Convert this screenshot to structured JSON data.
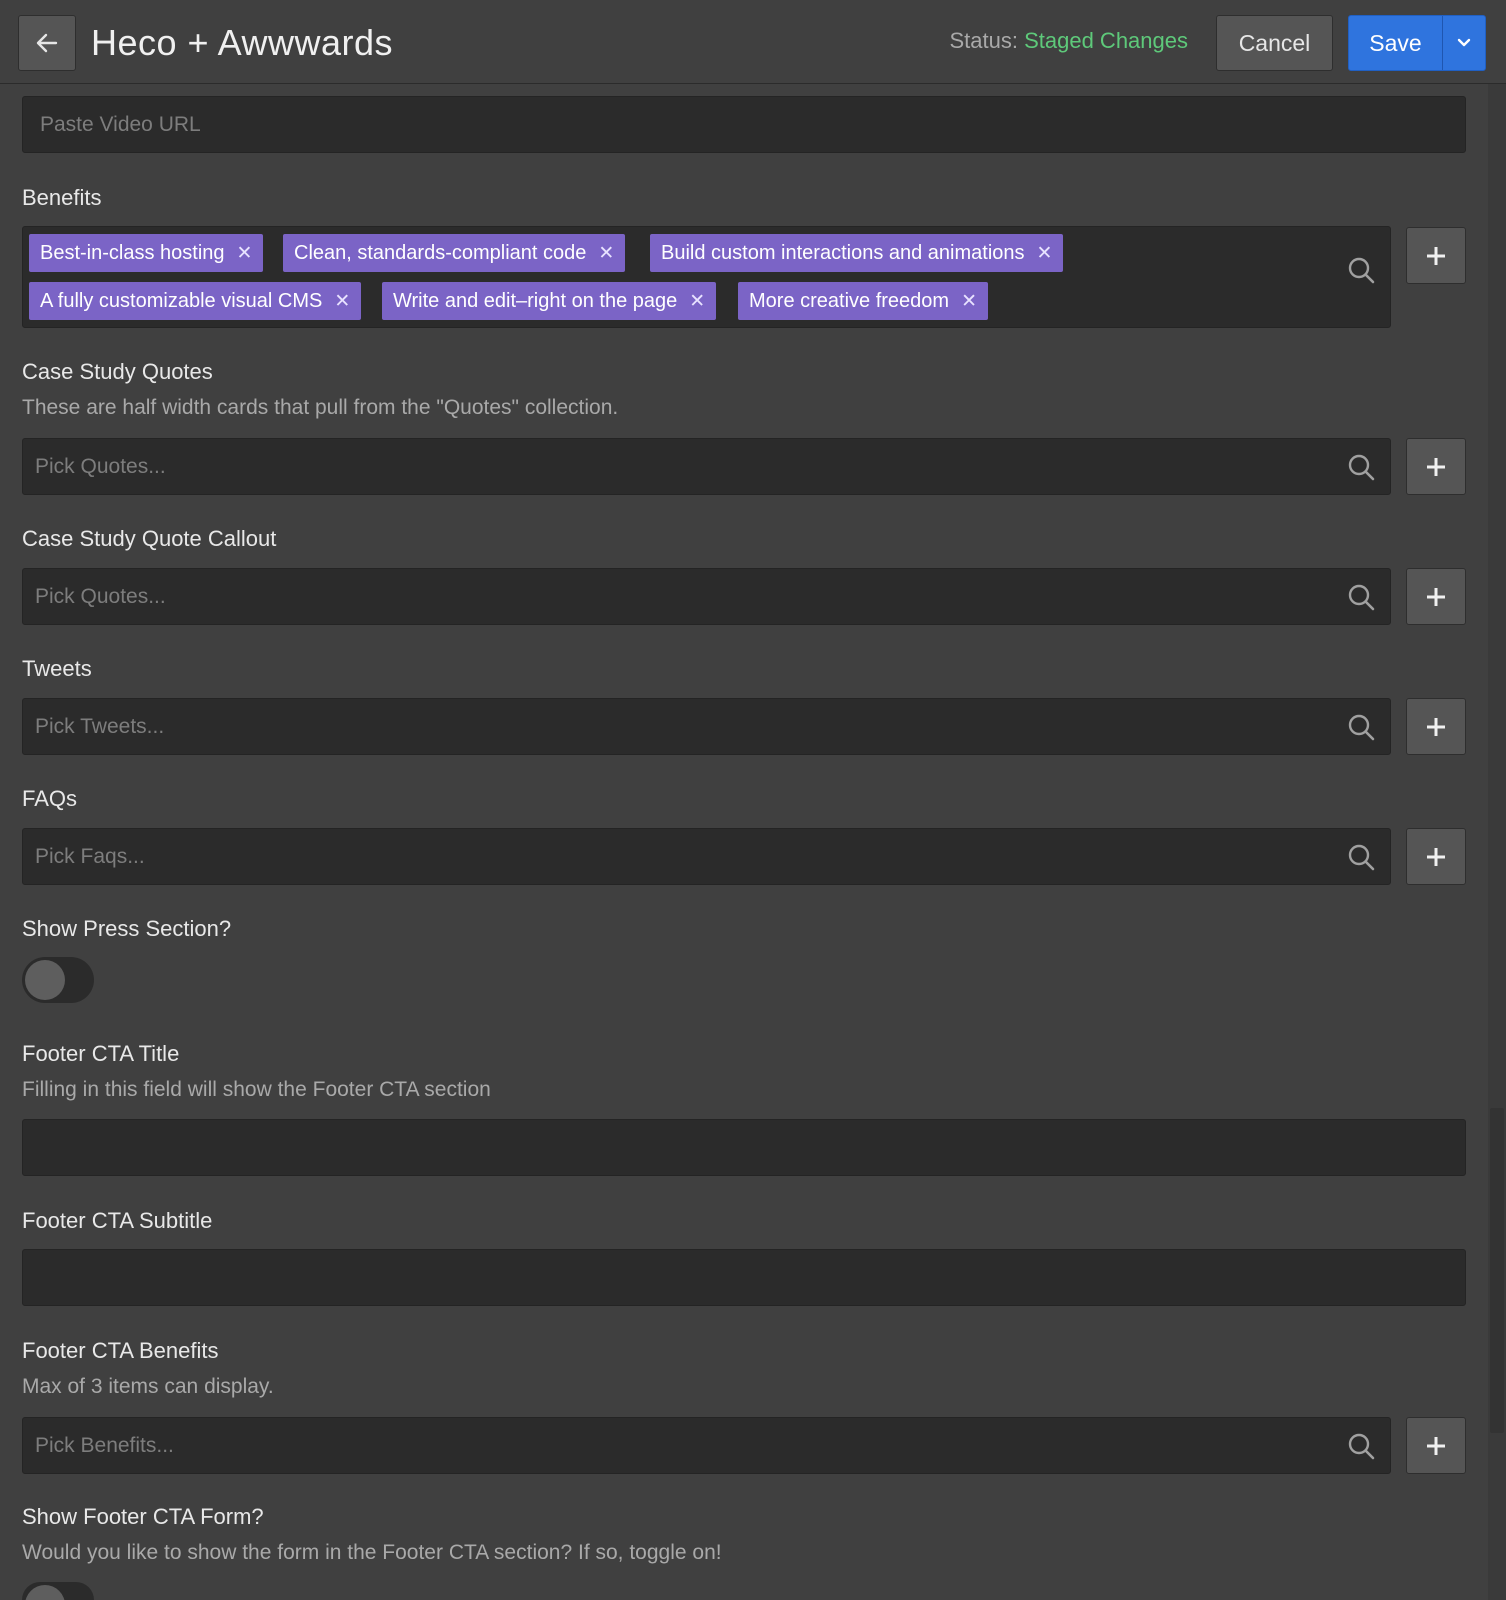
{
  "header": {
    "title": "Heco + Awwwards",
    "status_label": "Status:",
    "status_value": "Staged Changes",
    "cancel_label": "Cancel",
    "save_label": "Save"
  },
  "video": {
    "placeholder": "Paste Video URL"
  },
  "benefits": {
    "label": "Benefits",
    "tags": [
      "Best-in-class hosting",
      "Clean, standards-compliant code",
      "Build custom interactions and animations",
      "A fully customizable visual CMS",
      "Write and edit–right on the page",
      "More creative freedom"
    ]
  },
  "case_study_quotes": {
    "label": "Case Study Quotes",
    "help": "These are half width cards that pull from the \"Quotes\" collection.",
    "placeholder": "Pick Quotes..."
  },
  "case_study_quote_callout": {
    "label": "Case Study Quote Callout",
    "placeholder": "Pick Quotes..."
  },
  "tweets": {
    "label": "Tweets",
    "placeholder": "Pick Tweets..."
  },
  "faqs": {
    "label": "FAQs",
    "placeholder": "Pick Faqs..."
  },
  "press": {
    "label": "Show Press Section?",
    "enabled": false
  },
  "footer_cta_title": {
    "label": "Footer CTA Title",
    "help": "Filling in this field will show the Footer CTA section",
    "value": ""
  },
  "footer_cta_subtitle": {
    "label": "Footer CTA Subtitle",
    "value": ""
  },
  "footer_cta_benefits": {
    "label": "Footer CTA Benefits",
    "help": "Max of 3 items can display.",
    "placeholder": "Pick Benefits..."
  },
  "footer_cta_form": {
    "label": "Show Footer CTA Form?",
    "help": "Would you like to show the form in the Footer CTA section? If so, toggle on!",
    "enabled": false
  },
  "colors": {
    "accent": "#2f74de",
    "status": "#5ec97a",
    "tag": "#7b64c6"
  },
  "icons": [
    "arrow-left-icon",
    "chevron-down-icon",
    "search-icon",
    "plus-icon",
    "close-icon"
  ]
}
